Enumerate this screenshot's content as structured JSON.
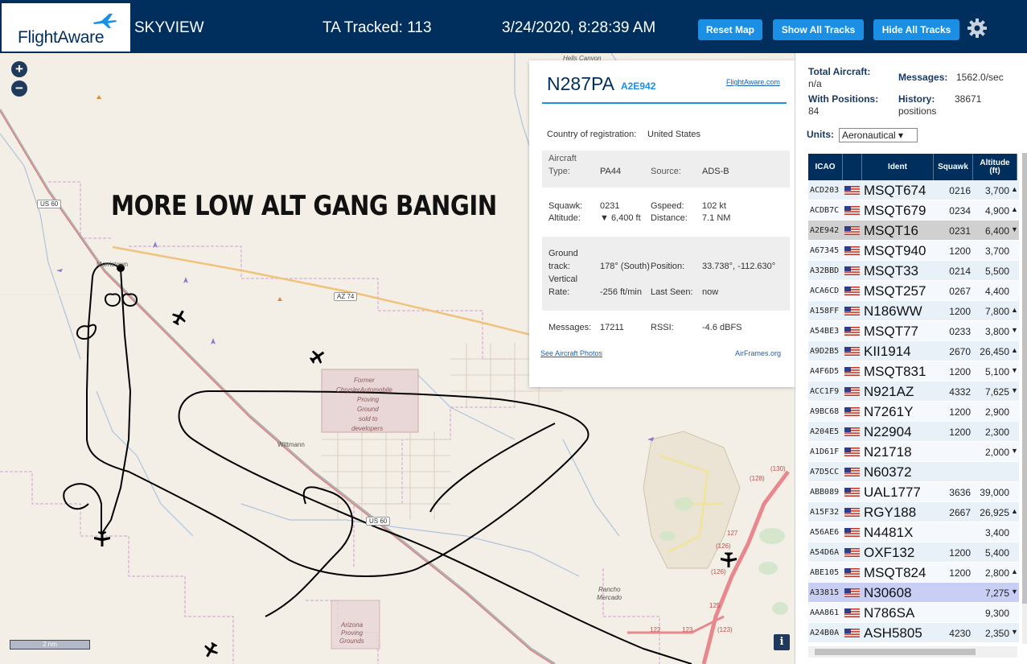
{
  "header": {
    "logo_text": "FlightAware",
    "app_name": "SKYVIEW",
    "tracked": "TA Tracked: 113",
    "datetime": "3/24/2020, 8:28:39 AM",
    "btn_reset": "Reset Map",
    "btn_show": "Show All Tracks",
    "btn_hide": "Hide All Tracks"
  },
  "map": {
    "zoom_in": "+",
    "zoom_out": "−",
    "overlay_text": "MORE LOW ALT GANG BANGIN",
    "labels": {
      "hells_canyon": "Hells Canyon",
      "us60_a": "US 60",
      "us60_b": "US 60",
      "az74": "AZ 74",
      "morristown": "Morristown",
      "former": "Former",
      "chrysler": "ChryslerAutomobile",
      "proving": "Proving",
      "ground": "Ground",
      "sold": "sold to",
      "developers": "developers",
      "wittmann": "Wittmann",
      "rancho": "Rancho",
      "mercado": "Mercado",
      "arizona": "Arizona",
      "proving2": "Proving",
      "grounds": "Grounds",
      "r130": "(130)",
      "r128": "(128)",
      "r127": "127",
      "r126": "(126)",
      "r126b": "(126)",
      "r125": "125",
      "r123": "(123)",
      "r122": "122",
      "r123b": "123"
    },
    "scale": "2 nm",
    "info": "i"
  },
  "popup": {
    "ident": "N287PA",
    "hex": "A2E942",
    "fa_link": "FlightAware.com",
    "country": "Country of registration:",
    "country_val": "United States",
    "aircraft": "Aircraft",
    "type_lbl": "Type:",
    "type_val": "PA44",
    "source_lbl": "Source:",
    "source_val": "ADS-B",
    "squawk_lbl": "Squawk:",
    "squawk_val": "0231",
    "gspeed_lbl": "Gspeed:",
    "gspeed_val": "102 kt",
    "alt_lbl": "Altitude:",
    "alt_val": "▼ 6,400 ft",
    "dist_lbl": "Distance:",
    "dist_val": "7.1 NM",
    "gt1": "Ground",
    "gt2": "track:",
    "gt_val": "178° (South)",
    "pos_lbl": "Position:",
    "pos_val": "33.738°, -112.630°",
    "vr1": "Vertical",
    "vr2": "Rate:",
    "vr_val": "-256 ft/min",
    "seen_lbl": "Last Seen:",
    "seen_val": "now",
    "msg_lbl": "Messages:",
    "msg_val": "17211",
    "rssi_lbl": "RSSI:",
    "rssi_val": "-4.6 dBFS",
    "photos_link": "See Aircraft Photos",
    "airframes_link": "AirFrames.org"
  },
  "panel": {
    "total_lbl": "Total Aircraft:",
    "total_val": "n/a",
    "msg_lbl": "Messages:",
    "msg_val": "1562.0/sec",
    "withpos_lbl": "With Positions:",
    "withpos_val": "84",
    "history_lbl": "History:",
    "history_val": "38671",
    "history_unit": "positions",
    "units_lbl": "Units:",
    "units_val": "Aeronautical ▾",
    "col_icao": "ICAO",
    "col_ident": "Ident",
    "col_squawk": "Squawk",
    "col_alt1": "Altitude",
    "col_alt2": "(ft)"
  },
  "rows": [
    {
      "icao": "ACD203",
      "ident": "MSQT674",
      "squawk": "0216",
      "alt": "3,700",
      "arrow": "▲"
    },
    {
      "icao": "ACDB7C",
      "ident": "MSQT679",
      "squawk": "0234",
      "alt": "4,900",
      "arrow": "▲"
    },
    {
      "icao": "A2E942",
      "ident": "MSQT16",
      "squawk": "0231",
      "alt": "6,400",
      "arrow": "▼"
    },
    {
      "icao": "A67345",
      "ident": "MSQT940",
      "squawk": "1200",
      "alt": "3,700",
      "arrow": ""
    },
    {
      "icao": "A32BBD",
      "ident": "MSQT33",
      "squawk": "0214",
      "alt": "5,500",
      "arrow": ""
    },
    {
      "icao": "ACA6CD",
      "ident": "MSQT257",
      "squawk": "0267",
      "alt": "4,400",
      "arrow": ""
    },
    {
      "icao": "A158FF",
      "ident": "N186WW",
      "squawk": "1200",
      "alt": "7,800",
      "arrow": "▲"
    },
    {
      "icao": "A54BE3",
      "ident": "MSQT77",
      "squawk": "0233",
      "alt": "3,800",
      "arrow": "▼"
    },
    {
      "icao": "A9D2B5",
      "ident": "KII1914",
      "squawk": "2670",
      "alt": "26,450",
      "arrow": "▲"
    },
    {
      "icao": "A4F6D5",
      "ident": "MSQT831",
      "squawk": "1200",
      "alt": "5,100",
      "arrow": "▼"
    },
    {
      "icao": "ACC1F9",
      "ident": "N921AZ",
      "squawk": "4332",
      "alt": "7,625",
      "arrow": "▼"
    },
    {
      "icao": "A9BC68",
      "ident": "N7261Y",
      "squawk": "1200",
      "alt": "2,900",
      "arrow": ""
    },
    {
      "icao": "A204E5",
      "ident": "N22904",
      "squawk": "1200",
      "alt": "2,300",
      "arrow": ""
    },
    {
      "icao": "A1D61F",
      "ident": "N21718",
      "squawk": "",
      "alt": "2,000",
      "arrow": "▼"
    },
    {
      "icao": "A7D5CC",
      "ident": "N60372",
      "squawk": "",
      "alt": "",
      "arrow": ""
    },
    {
      "icao": "ABB089",
      "ident": "UAL1777",
      "squawk": "3636",
      "alt": "39,000",
      "arrow": ""
    },
    {
      "icao": "A15F32",
      "ident": "RGY188",
      "squawk": "2667",
      "alt": "26,925",
      "arrow": "▲"
    },
    {
      "icao": "A56AE6",
      "ident": "N4481X",
      "squawk": "",
      "alt": "3,400",
      "arrow": ""
    },
    {
      "icao": "A54D6A",
      "ident": "OXF132",
      "squawk": "1200",
      "alt": "5,400",
      "arrow": ""
    },
    {
      "icao": "ABE105",
      "ident": "MSQT824",
      "squawk": "1200",
      "alt": "2,800",
      "arrow": "▲"
    },
    {
      "icao": "A33815",
      "ident": "N30608",
      "squawk": "",
      "alt": "7,275",
      "arrow": "▼"
    },
    {
      "icao": "AAA861",
      "ident": "N786SA",
      "squawk": "",
      "alt": "9,300",
      "arrow": ""
    },
    {
      "icao": "A24B0A",
      "ident": "ASH5805",
      "squawk": "4230",
      "alt": "2,350",
      "arrow": "▼"
    }
  ],
  "colors": {
    "header_bg": "#002f5d",
    "button_bg": "#1a8fe3",
    "selected_row": "#d0d0d0",
    "highlight_row": "#c9cff4"
  },
  "icons": [
    "plane-logo-icon",
    "gear-icon",
    "us-flag-icon",
    "aircraft-icon"
  ]
}
